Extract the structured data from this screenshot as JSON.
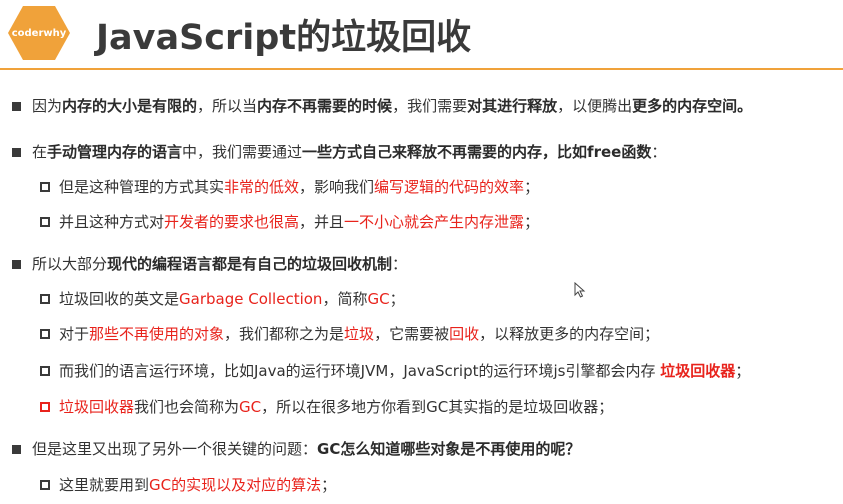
{
  "header": {
    "logo_text": "coderwhy",
    "title": "JavaScript的垃圾回收",
    "accent_color": "#f0a23a"
  },
  "colors": {
    "highlight": "#e8231c",
    "text": "#333333"
  },
  "lines": [
    {
      "segs": [
        "因为",
        "内存的大小是有限的",
        "，所以当",
        "内存不再需要的时候",
        "，我们需要",
        "对其进行释放",
        "，以便腾出",
        "更多的内存空间。"
      ]
    },
    {
      "segs": [
        "在",
        "手动管理内存的语言",
        "中，我们需要通过",
        "一些方式自己来释放不再需要的内存，比如free函数",
        "："
      ]
    },
    {
      "segs": [
        "但是这种管理的方式其实",
        "非常的低效",
        "，影响我们",
        "编写逻辑的代码的效率",
        "；"
      ]
    },
    {
      "segs": [
        "并且这种方式对",
        "开发者的要求也很高",
        "，并且",
        "一不小心就会产生内存泄露",
        "；"
      ]
    },
    {
      "segs": [
        "所以大部分",
        "现代的编程语言都是有自己的垃圾回收机制",
        "："
      ]
    },
    {
      "segs": [
        "垃圾回收的英文是",
        "Garbage Collection",
        "，简称",
        "GC",
        "；"
      ]
    },
    {
      "segs": [
        "对于",
        "那些不再使用的对象",
        "，我们都称之为是",
        "垃圾",
        "，它需要被",
        "回收",
        "，以释放更多的内存空间；"
      ]
    },
    {
      "segs": [
        "而我们的语言运行环境，比如Java的运行环境JVM，JavaScript的运行环境js引擎都会内存 ",
        "垃圾回收器",
        "；"
      ]
    },
    {
      "segs": [
        "垃圾回收器",
        "我们也会简称为",
        "GC",
        "，所以在很多地方你看到GC其实指的是垃圾回收器；"
      ]
    },
    {
      "segs": [
        "但是这里又出现了另外一个很关键的问题：",
        "GC怎么知道哪些对象是不再使用的呢？"
      ]
    },
    {
      "segs": [
        "这里就要用到",
        "GC的实现以及对应的算法",
        "；"
      ]
    }
  ]
}
